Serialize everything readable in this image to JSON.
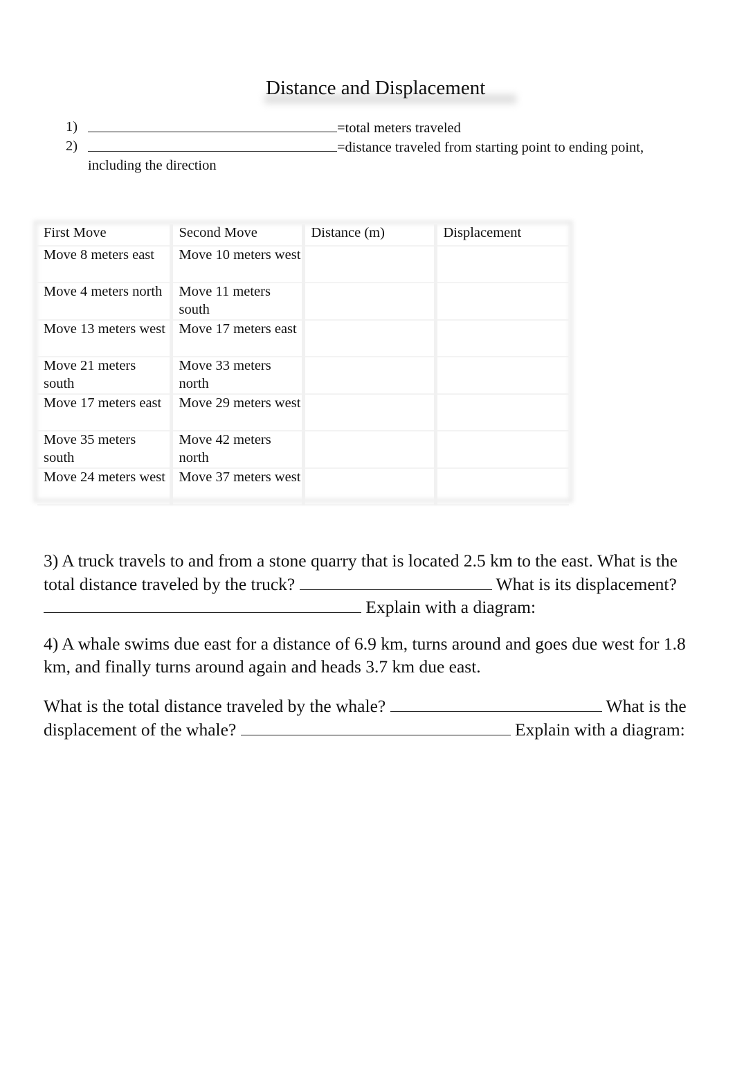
{
  "document": {
    "title": "Distance and Displacement",
    "definitions": [
      {
        "number": "1)",
        "text": "=total meters traveled"
      },
      {
        "number": "2)",
        "text": "=distance traveled from starting point to ending point, including the direction"
      }
    ],
    "table": {
      "headers": [
        "First Move",
        "Second Move",
        "Distance (m)",
        "Displacement"
      ],
      "rows": [
        {
          "first": "Move 8 meters east",
          "second": "Move 10 meters west",
          "distance": "",
          "displacement": ""
        },
        {
          "first": "Move 4 meters north",
          "second": "Move 11 meters south",
          "distance": "",
          "displacement": ""
        },
        {
          "first": "Move 13 meters west",
          "second": "Move 17 meters east",
          "distance": "",
          "displacement": ""
        },
        {
          "first": "Move 21 meters south",
          "second": "Move 33 meters north",
          "distance": "",
          "displacement": ""
        },
        {
          "first": "Move 17 meters east",
          "second": "Move 29 meters west",
          "distance": "",
          "displacement": ""
        },
        {
          "first": "Move 35 meters south",
          "second": "Move 42 meters north",
          "distance": "",
          "displacement": ""
        },
        {
          "first": "Move 24 meters west",
          "second": "Move 37 meters west",
          "distance": "",
          "displacement": ""
        }
      ]
    },
    "question3": {
      "part1": "3) A truck travels to and from a stone quarry that is located 2.5 km to the east. What is the total distance traveled by the truck? ",
      "part2": " What is its displacement? ",
      "part3": " Explain with a diagram:"
    },
    "question4": {
      "statement": "4) A whale swims due east for a distance of 6.9 km, turns around and goes due west for 1.8 km, and finally turns around again and heads 3.7 km due east.",
      "part1": "What is the total distance traveled by the whale? ",
      "part2": " What is the displacement of the whale? ",
      "part3": " Explain with a diagram:"
    }
  }
}
